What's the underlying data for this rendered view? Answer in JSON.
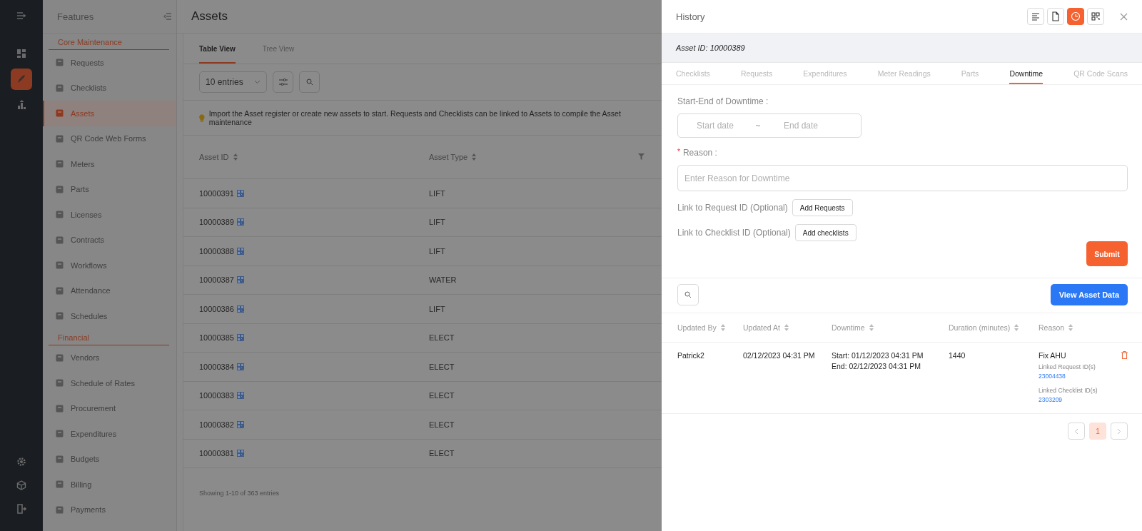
{
  "rail": {
    "items": [
      {
        "selected": false
      },
      {
        "selected": true
      },
      {
        "selected": false
      }
    ]
  },
  "sidebar": {
    "title": "Features",
    "sections": [
      {
        "title": "Core Maintenance",
        "items": [
          {
            "label": "Requests",
            "selected": false
          },
          {
            "label": "Checklists",
            "selected": false
          },
          {
            "label": "Assets",
            "selected": true
          },
          {
            "label": "QR Code Web Forms",
            "selected": false
          },
          {
            "label": "Meters",
            "selected": false
          },
          {
            "label": "Parts",
            "selected": false
          },
          {
            "label": "Licenses",
            "selected": false
          },
          {
            "label": "Contracts",
            "selected": false
          },
          {
            "label": "Workflows",
            "selected": false
          },
          {
            "label": "Attendance",
            "selected": false
          },
          {
            "label": "Schedules",
            "selected": false
          }
        ]
      },
      {
        "title": "Financial",
        "items": [
          {
            "label": "Vendors",
            "selected": false
          },
          {
            "label": "Schedule of Rates",
            "selected": false
          },
          {
            "label": "Procurement",
            "selected": false
          },
          {
            "label": "Expenditures",
            "selected": false
          },
          {
            "label": "Budgets",
            "selected": false
          },
          {
            "label": "Billing",
            "selected": false
          },
          {
            "label": "Payments",
            "selected": false
          }
        ]
      }
    ]
  },
  "main": {
    "title": "Assets",
    "tabs": [
      {
        "label": "Table View",
        "selected": true
      },
      {
        "label": "Tree View",
        "selected": false
      }
    ],
    "entries": "10 entries",
    "notice": "Import the Asset register or create new assets to start. Requests and Checklists can be linked to Assets to compile the Asset maintenance",
    "table": {
      "columns": [
        "Asset ID",
        "Asset Type"
      ],
      "rows": [
        {
          "id": "10000391",
          "type": "LIFT"
        },
        {
          "id": "10000389",
          "type": "LIFT"
        },
        {
          "id": "10000388",
          "type": "LIFT"
        },
        {
          "id": "10000387",
          "type": "WATER"
        },
        {
          "id": "10000386",
          "type": "LIFT"
        },
        {
          "id": "10000385",
          "type": "ELECT"
        },
        {
          "id": "10000384",
          "type": "ELECT"
        },
        {
          "id": "10000383",
          "type": "ELECT"
        },
        {
          "id": "10000382",
          "type": "ELECT"
        },
        {
          "id": "10000381",
          "type": "ELECT"
        }
      ]
    },
    "footer": "Showing 1-10 of 363 entries"
  },
  "drawer": {
    "title": "History",
    "toolbar": [
      {
        "selected": false
      },
      {
        "selected": false
      },
      {
        "selected": true
      },
      {
        "selected": false
      }
    ],
    "asset_id": "Asset ID: 10000389",
    "tabs": [
      {
        "label": "Checklists",
        "selected": false
      },
      {
        "label": "Requests",
        "selected": false
      },
      {
        "label": "Expenditures",
        "selected": false
      },
      {
        "label": "Meter Readings",
        "selected": false
      },
      {
        "label": "Parts",
        "selected": false
      },
      {
        "label": "Downtime",
        "selected": true
      },
      {
        "label": "QR Code Scans",
        "selected": false
      }
    ],
    "form": {
      "date_label": "Start-End of Downtime :",
      "start_placeholder": "Start date",
      "separator": "~",
      "end_placeholder": "End date",
      "reason_required_mark": "*",
      "reason_label": "Reason :",
      "reason_placeholder": "Enter Reason for Downtime",
      "links": [
        {
          "label": "Link to Request ID (Optional)",
          "button": "Add Requests"
        },
        {
          "label": "Link to Checklist ID (Optional)",
          "button": "Add checklists"
        }
      ],
      "submit": "Submit"
    },
    "view_button": "View Asset Data",
    "table": {
      "columns": [
        "Updated By",
        "Updated At",
        "Downtime",
        "Duration (minutes)",
        "Reason"
      ],
      "rows": [
        {
          "updated_by": "Patrick2",
          "updated_at": "02/12/2023 04:31 PM",
          "downtime_start": "Start: 01/12/2023 04:31 PM",
          "downtime_end": "End: 02/12/2023 04:31 PM",
          "duration": "1440",
          "reason": "Fix AHU",
          "request_label": "Linked Request ID(s)",
          "request_id": "23004438",
          "checklist_label": "Linked Checklist ID(s)",
          "checklist_id": "2303209"
        }
      ]
    },
    "pages": [
      {
        "label": "1",
        "selected": true
      }
    ]
  }
}
